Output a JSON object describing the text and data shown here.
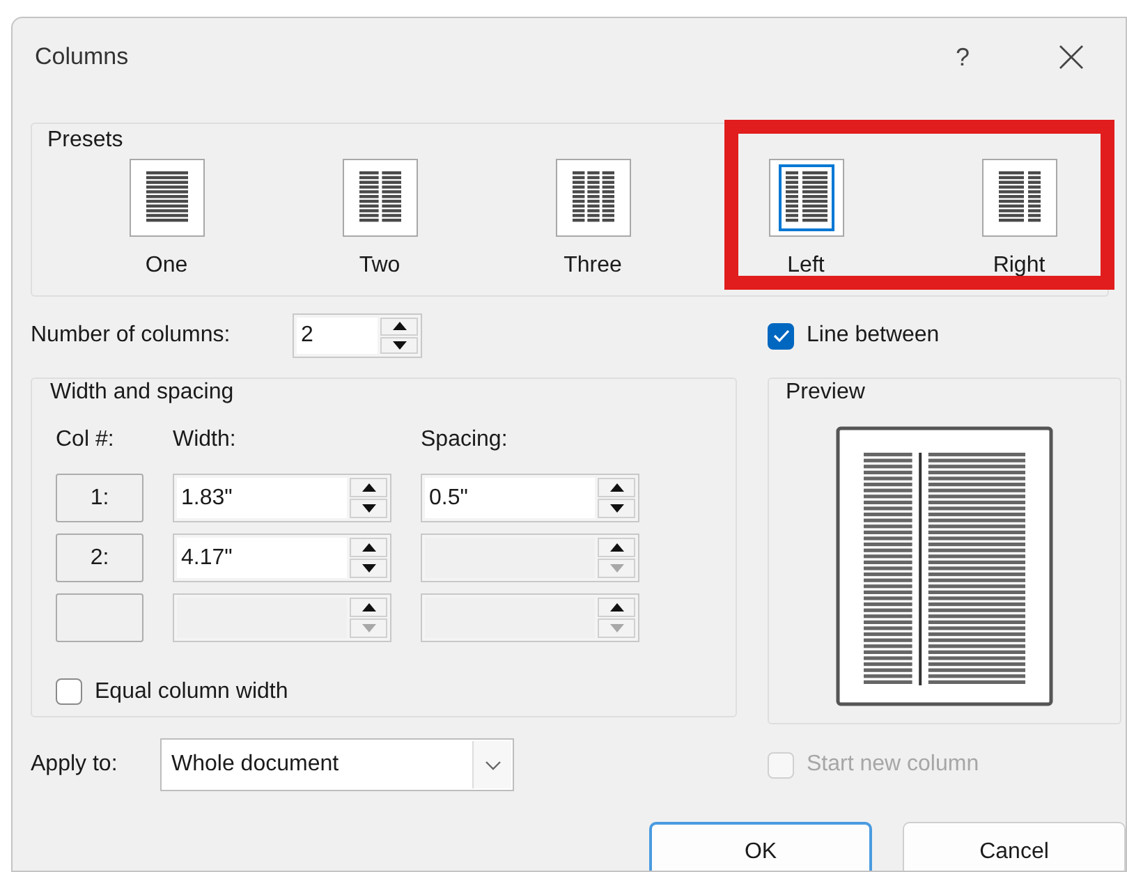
{
  "window": {
    "title": "Columns",
    "help_button": "?"
  },
  "presets": {
    "title": "Presets",
    "items": [
      {
        "label": "One",
        "kind": "one",
        "selected": false,
        "highlighted": false
      },
      {
        "label": "Two",
        "kind": "two",
        "selected": false,
        "highlighted": false
      },
      {
        "label": "Three",
        "kind": "three",
        "selected": false,
        "highlighted": false
      },
      {
        "label": "Left",
        "kind": "left",
        "selected": true,
        "highlighted": true
      },
      {
        "label": "Right",
        "kind": "right",
        "selected": false,
        "highlighted": true
      }
    ]
  },
  "number_of_columns": {
    "label": "Number of columns:",
    "value": "2"
  },
  "line_between": {
    "label": "Line between",
    "checked": true
  },
  "width_and_spacing": {
    "title": "Width and spacing",
    "headers": [
      "Col #:",
      "Width:",
      "Spacing:"
    ],
    "rows": [
      {
        "col": "1:",
        "width": "1.83\"",
        "spacing": "0.5\"",
        "width_disabled": false,
        "spacing_disabled": false
      },
      {
        "col": "2:",
        "width": "4.17\"",
        "width_disabled": false,
        "spacing_disabled": true
      },
      {
        "width_disabled": true,
        "spacing_disabled": true
      }
    ]
  },
  "equal_column_width": {
    "label": "Equal column width",
    "checked": false
  },
  "preview": {
    "title": "Preview"
  },
  "apply_to": {
    "label": "Apply to:",
    "value": "Whole document"
  },
  "start_new_column": {
    "label": "Start new column",
    "checked": false,
    "disabled": true
  },
  "buttons": [
    {
      "label": "OK",
      "default": true
    },
    {
      "label": "Cancel",
      "default": false
    }
  ]
}
